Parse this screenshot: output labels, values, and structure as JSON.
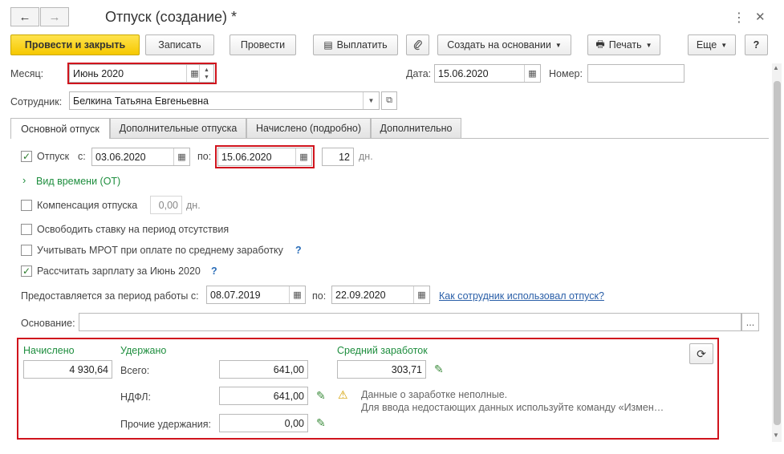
{
  "window": {
    "title": "Отпуск (создание) *",
    "more_menu_glyph": "⋮",
    "close_glyph": "✕"
  },
  "nav": {
    "back_glyph": "←",
    "forward_glyph": "→"
  },
  "toolbar": {
    "post_close": "Провести и закрыть",
    "write": "Записать",
    "post": "Провести",
    "pay": "Выплатить",
    "create_based": "Создать на основании",
    "print": "Печать",
    "more": "Еще",
    "help": "?"
  },
  "header": {
    "month_label": "Месяц:",
    "month_value": "Июнь 2020",
    "date_label": "Дата:",
    "date_value": "15.06.2020",
    "number_label": "Номер:",
    "number_value": "",
    "employee_label": "Сотрудник:",
    "employee_value": "Белкина Татьяна Евгеньевна"
  },
  "tabs": [
    {
      "label": "Основной отпуск",
      "active": true
    },
    {
      "label": "Дополнительные отпуска",
      "active": false
    },
    {
      "label": "Начислено (подробно)",
      "active": false
    },
    {
      "label": "Дополнительно",
      "active": false
    }
  ],
  "vacation": {
    "checked": true,
    "label": "Отпуск",
    "from_label": "с:",
    "from_value": "03.06.2020",
    "to_label": "по:",
    "to_value": "15.06.2020",
    "days_value": "12",
    "days_unit": "дн."
  },
  "time_type": {
    "label": "Вид времени (ОТ)"
  },
  "compensation": {
    "checked": false,
    "label": "Компенсация отпуска",
    "value": "0,00",
    "unit": "дн."
  },
  "release_rate": {
    "checked": false,
    "label": "Освободить ставку на период отсутствия"
  },
  "mrot": {
    "checked": false,
    "label": "Учитывать МРОТ при оплате по среднему заработку",
    "help": "?"
  },
  "calc_salary": {
    "checked": true,
    "label": "Рассчитать зарплату за Июнь 2020",
    "help": "?"
  },
  "period": {
    "label": "Предоставляется за период работы с:",
    "from_value": "08.07.2019",
    "to_label": "по:",
    "to_value": "22.09.2020",
    "link": "Как сотрудник использовал отпуск?"
  },
  "basis": {
    "label": "Основание:",
    "value": "",
    "button": "..."
  },
  "totals": {
    "accrued_label": "Начислено",
    "accrued_value": "4 930,64",
    "withheld_label": "Удержано",
    "total_label": "Всего:",
    "total_value": "641,00",
    "ndfl_label": "НДФЛ:",
    "ndfl_value": "641,00",
    "other_label": "Прочие удержания:",
    "other_value": "0,00",
    "avg_label": "Средний заработок",
    "avg_value": "303,71",
    "warning_line1": "Данные о заработке неполные.",
    "warning_line2": "Для ввода недостающих данных используйте команду «Измен…"
  },
  "colors": {
    "accent_green": "#1e8e3e",
    "highlight_red": "#d0141d",
    "primary_yellow": "#f6c800",
    "link_blue": "#2a5fa8"
  }
}
